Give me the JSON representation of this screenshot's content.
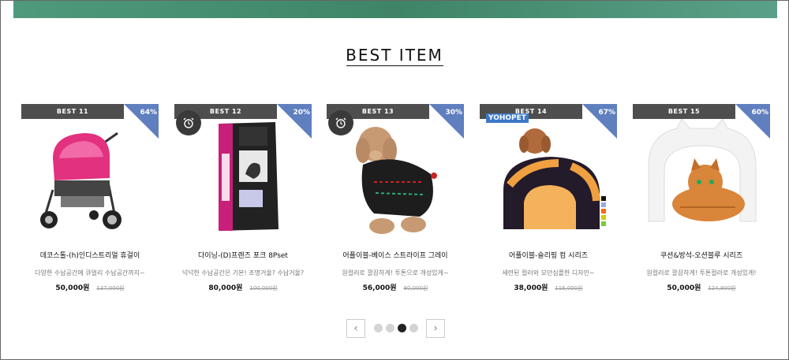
{
  "section": {
    "title": "BEST ITEM"
  },
  "colors": {
    "topbar": "#4b8f72",
    "badge": "#4e4e4e",
    "discount": "#5f7fbf"
  },
  "products": [
    {
      "badge": "BEST 11",
      "discount": "64%",
      "name": "데코스톨-(h)인디스트리얼 휴걸이",
      "desc": "다양한 수납공간에 큐얼리 수납공간까지~",
      "price": "50,000원",
      "old_price": "137,000원",
      "alarm": false,
      "image": "pink-pet-stroller"
    },
    {
      "badge": "BEST 12",
      "discount": "20%",
      "name": "다이닝-(D)프렌즈 포크 8Pset",
      "desc": "넉넉한 수납공간은 기본! 조명거울? 수납거울?",
      "price": "80,000원",
      "old_price": "100,000원",
      "alarm": true,
      "image": "eukanuba-dog-food-bag"
    },
    {
      "badge": "BEST 13",
      "discount": "30%",
      "name": "어플이블-베이스 스트라이프 그레이",
      "desc": "원컬러로 깔끔하게! 투톤으로 개성있게~",
      "price": "56,000원",
      "old_price": "80,000원",
      "alarm": true,
      "image": "dog-in-sweater"
    },
    {
      "badge": "BEST 14",
      "discount": "67%",
      "name": "어플이블-슬리핑 컴 시리즈",
      "desc": "세련된 컬러와 모던심플한 디자인~",
      "price": "38,000원",
      "old_price": "116,000원",
      "alarm": false,
      "brand": "YOHOPET",
      "image": "dog-house-bed"
    },
    {
      "badge": "BEST 15",
      "discount": "60%",
      "name": "쿠션&방석-오션블루 시리즈",
      "desc": "원컬러로 깔끔하게! 투톤컬러로 개성있게!",
      "price": "50,000원",
      "old_price": "124,800원",
      "alarm": false,
      "image": "cat-window-door"
    }
  ],
  "pagination": {
    "prev": "‹",
    "next": "›",
    "pages": 4,
    "active": 3
  }
}
